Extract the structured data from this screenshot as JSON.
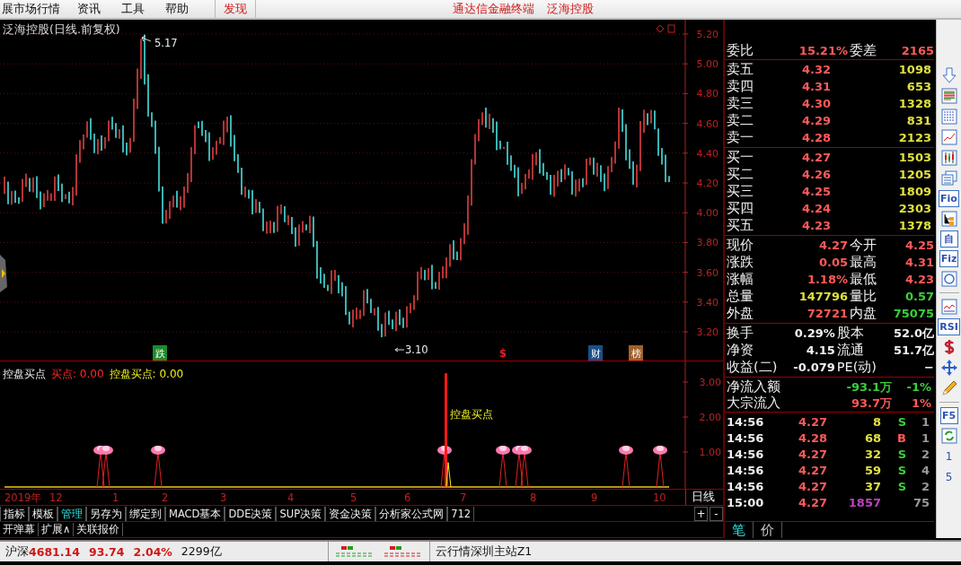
{
  "menu_bar": {
    "items": [
      "展市场行情",
      "资讯",
      "工具",
      "帮助"
    ],
    "discover": "发现",
    "center_links": [
      "通达信金融终端",
      "泛海控股"
    ]
  },
  "price_chart": {
    "title": "泛海控股(日线.前复权)",
    "high_label": "5.17",
    "low_label": "3.10",
    "y_axis": [
      "5.20",
      "5.00",
      "4.80",
      "4.60",
      "4.40",
      "4.20",
      "4.00",
      "3.80",
      "3.60",
      "3.40",
      "3.20"
    ],
    "event_marks": [
      {
        "label": "跌",
        "color": "#1c8a2c"
      },
      {
        "label": "$",
        "color": "#e02020"
      },
      {
        "label": "财",
        "color": "#1a4f8a"
      },
      {
        "label": "榜",
        "color": "#a0602a"
      }
    ]
  },
  "indicator": {
    "name": "控盘买点",
    "legend": [
      {
        "label": "买点: 0.00",
        "color": "#ff2a2a"
      },
      {
        "label": "控盘买点: 0.00",
        "color": "#f0f020"
      }
    ],
    "signal_label": "控盘买点",
    "y_axis": [
      "3.00",
      "2.00",
      "1.00"
    ]
  },
  "date_axis": {
    "labels": [
      "2019年",
      "12",
      "1",
      "2",
      "3",
      "4",
      "5",
      "6",
      "7",
      "8",
      "9",
      "10"
    ],
    "period": "日线"
  },
  "indicator_tabs": [
    {
      "label": "指标",
      "selected": false
    },
    {
      "label": "模板",
      "selected": false
    },
    {
      "label": "管理",
      "selected": true
    },
    {
      "label": "另存为",
      "selected": false
    },
    {
      "label": "绑定到",
      "selected": false
    },
    {
      "label": "MACD基本",
      "selected": false
    },
    {
      "label": "DDE决策",
      "selected": false
    },
    {
      "label": "SUP决策",
      "selected": false
    },
    {
      "label": "资金决策",
      "selected": false
    },
    {
      "label": "分析家公式网",
      "selected": false
    },
    {
      "label": "712",
      "selected": false
    }
  ],
  "tab_controls": [
    "+",
    "-"
  ],
  "extra_buttons": [
    "开弹幕",
    "扩展∧",
    "关联报价"
  ],
  "quote": {
    "commission": [
      {
        "label": "委比",
        "value": "15.21%"
      },
      {
        "label": "委差",
        "value": "2165"
      }
    ],
    "asks": [
      {
        "label": "卖五",
        "price": "4.32",
        "volume": "1098"
      },
      {
        "label": "卖四",
        "price": "4.31",
        "volume": "653"
      },
      {
        "label": "卖三",
        "price": "4.30",
        "volume": "1328"
      },
      {
        "label": "卖二",
        "price": "4.29",
        "volume": "831"
      },
      {
        "label": "卖一",
        "price": "4.28",
        "volume": "2123"
      }
    ],
    "bids": [
      {
        "label": "买一",
        "price": "4.27",
        "volume": "1503"
      },
      {
        "label": "买二",
        "price": "4.26",
        "volume": "1205"
      },
      {
        "label": "买三",
        "price": "4.25",
        "volume": "1809"
      },
      {
        "label": "买四",
        "price": "4.24",
        "volume": "2303"
      },
      {
        "label": "买五",
        "price": "4.23",
        "volume": "1378"
      }
    ],
    "stats": [
      {
        "label": "现价",
        "value": "4.27",
        "color": "#ff5a5a"
      },
      {
        "label": "今开",
        "value": "4.25",
        "color": "#ff5a5a"
      },
      {
        "label": "涨跌",
        "value": "0.05",
        "color": "#ff5a5a"
      },
      {
        "label": "最高",
        "value": "4.31",
        "color": "#ff5a5a"
      },
      {
        "label": "涨幅",
        "value": "1.18%",
        "color": "#ff5a5a"
      },
      {
        "label": "最低",
        "value": "4.23",
        "color": "#ff5a5a"
      },
      {
        "label": "总量",
        "value": "147796",
        "color": "#e0e040"
      },
      {
        "label": "量比",
        "value": "0.57",
        "color": "#3ad03a"
      },
      {
        "label": "外盘",
        "value": "72721",
        "color": "#ff5a5a"
      },
      {
        "label": "内盘",
        "value": "75075",
        "color": "#3ad03a"
      }
    ],
    "fundamentals": [
      {
        "label": "换手",
        "value": "0.29%"
      },
      {
        "label": "股本",
        "value": "52.0亿"
      },
      {
        "label": "净资",
        "value": "4.15"
      },
      {
        "label": "流通",
        "value": "51.7亿"
      },
      {
        "label": "收益(二)",
        "value": "-0.079"
      },
      {
        "label": "PE(动)",
        "value": "−"
      }
    ],
    "flows": [
      {
        "label": "净流入额",
        "amount": "-93.1万",
        "pct": "-1%",
        "color": "#3ad03a"
      },
      {
        "label": "大宗流入",
        "amount": "93.7万",
        "pct": "1%",
        "color": "#ff5a5a"
      }
    ],
    "trades": [
      {
        "time": "14:56",
        "price": "4.27",
        "volume": "8",
        "side": "S",
        "count": "1",
        "color": "#e0e040"
      },
      {
        "time": "14:56",
        "price": "4.28",
        "volume": "68",
        "side": "B",
        "count": "1",
        "color": "#e0e040"
      },
      {
        "time": "14:56",
        "price": "4.27",
        "volume": "32",
        "side": "S",
        "count": "2",
        "color": "#e0e040"
      },
      {
        "time": "14:56",
        "price": "4.27",
        "volume": "59",
        "side": "S",
        "count": "4",
        "color": "#e0e040"
      },
      {
        "time": "14:56",
        "price": "4.27",
        "volume": "37",
        "side": "S",
        "count": "2",
        "color": "#e0e040"
      },
      {
        "time": "15:00",
        "price": "4.27",
        "volume": "1857",
        "count": "75",
        "color": "#c040c0"
      }
    ],
    "tabs": [
      {
        "label": "笔",
        "selected": true
      },
      {
        "label": "价",
        "selected": false
      }
    ]
  },
  "toolbar": [
    {
      "kind": "icon"
    },
    {
      "kind": "icon"
    },
    {
      "kind": "icon"
    },
    {
      "kind": "icon"
    },
    {
      "kind": "icon"
    },
    {
      "kind": "icon"
    },
    {
      "kind": "text",
      "label": "Fio"
    },
    {
      "kind": "icon"
    },
    {
      "kind": "text",
      "label": "自"
    },
    {
      "kind": "text",
      "label": "Fiz"
    },
    {
      "kind": "icon"
    },
    {
      "kind": "divider"
    },
    {
      "kind": "icon"
    },
    {
      "kind": "text",
      "label": "RSI"
    },
    {
      "kind": "icon"
    },
    {
      "kind": "icon"
    },
    {
      "kind": "icon"
    },
    {
      "kind": "divider"
    },
    {
      "kind": "text",
      "label": "F5"
    },
    {
      "kind": "icon"
    },
    {
      "kind": "number",
      "label": "1"
    },
    {
      "kind": "number",
      "label": "5"
    }
  ],
  "status_bar": {
    "index_name": "沪深",
    "index_value": "4681.14",
    "change": "93.74",
    "change_pct": "2.04%",
    "turnover": "2299亿",
    "server": "云行情深圳主站Z1"
  }
}
